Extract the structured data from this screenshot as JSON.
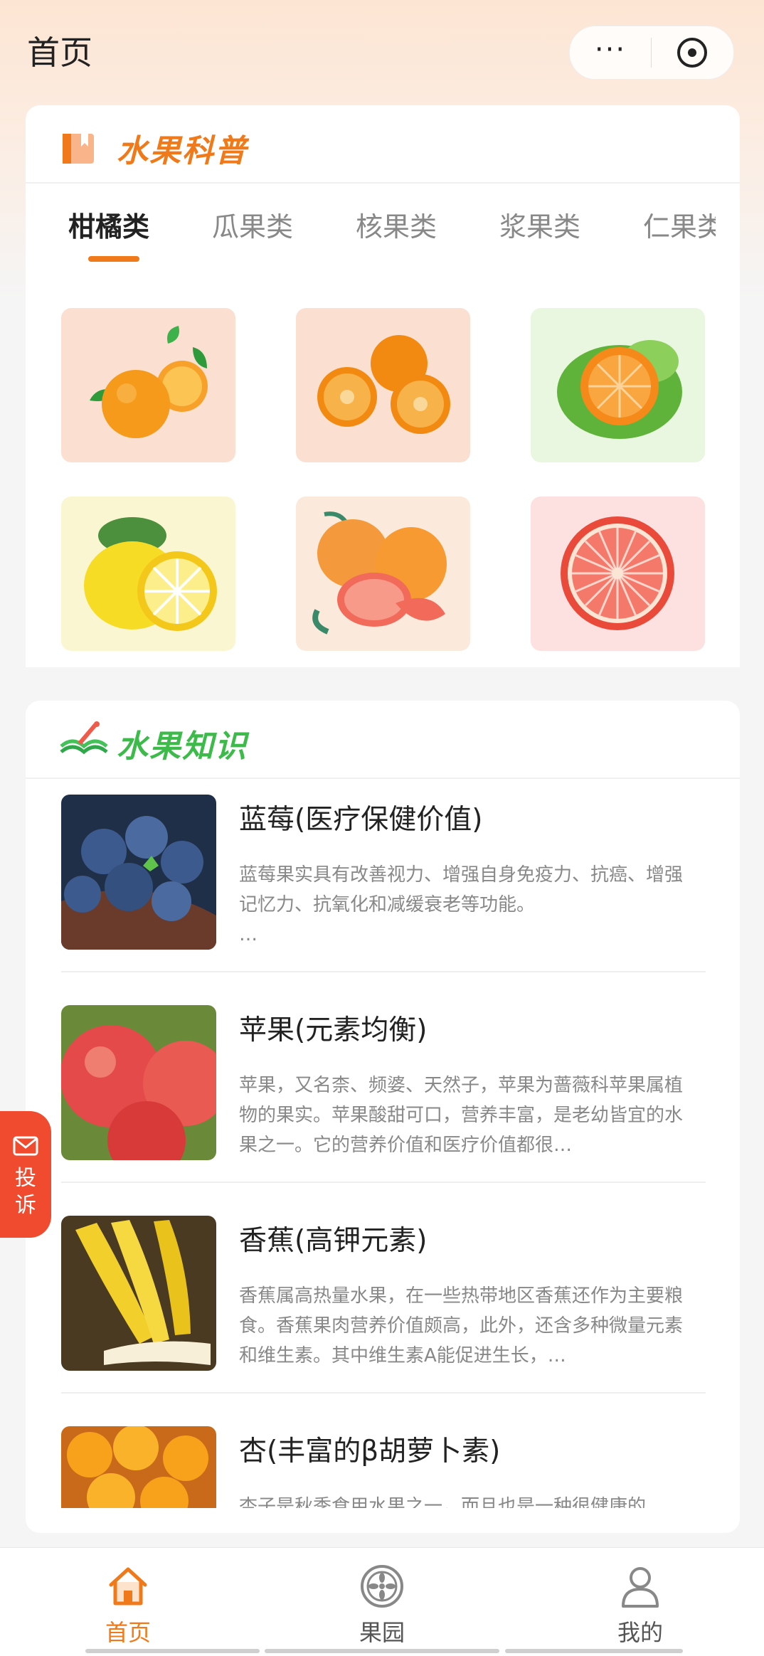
{
  "nav": {
    "title": "首页",
    "more_glyph": "···",
    "close_icon": "close-circle-icon"
  },
  "science": {
    "title": "水果科普",
    "icon": "book-icon",
    "accent": "#f07a1a",
    "tabs": [
      {
        "label": "柑橘类",
        "active": true
      },
      {
        "label": "瓜果类",
        "active": false
      },
      {
        "label": "核果类",
        "active": false
      },
      {
        "label": "浆果类",
        "active": false
      },
      {
        "label": "仁果类",
        "active": false
      }
    ],
    "tiles": [
      {
        "name": "orange",
        "bg": "#fbe0d2"
      },
      {
        "name": "kumquat",
        "bg": "#fbe0d2"
      },
      {
        "name": "green-tangerine",
        "bg": "#eaf7e0"
      },
      {
        "name": "lemon",
        "bg": "#fbf6d2"
      },
      {
        "name": "grapefruit",
        "bg": "#fbeadb"
      },
      {
        "name": "grapefruit-slice",
        "bg": "#fde0e0"
      }
    ]
  },
  "knowledge": {
    "title": "水果知识",
    "icon": "reading-icon",
    "accent": "#3dbb4a",
    "articles": [
      {
        "title": "蓝莓(医疗保健价值)",
        "desc": "蓝莓果实具有改善视力、增强自身免疫力、抗癌、增强记忆力、抗氧化和减缓衰老等功能。\n…",
        "thumb": "blueberry"
      },
      {
        "title": "苹果(元素均衡)",
        "desc": "苹果，又名柰、频婆、天然子，苹果为蔷薇科苹果属植物的果实。苹果酸甜可口，营养丰富，是老幼皆宜的水果之一。它的营养价值和医疗价值都很…",
        "thumb": "apple"
      },
      {
        "title": "香蕉(高钾元素)",
        "desc": "香蕉属高热量水果，在一些热带地区香蕉还作为主要粮食。香蕉果肉营养价值颇高，此外，还含多种微量元素和维生素。其中维生素A能促进生长，…",
        "thumb": "banana"
      },
      {
        "title": "杏(丰富的β胡萝卜素)",
        "desc": "杏子是秋季食用水果之一，而且也是一种很健康的",
        "thumb": "apricot"
      }
    ]
  },
  "complaint": {
    "label": "投诉",
    "icon": "mail-icon"
  },
  "tabbar": {
    "items": [
      {
        "label": "首页",
        "icon": "home-icon",
        "active": true
      },
      {
        "label": "果园",
        "icon": "orchard-icon",
        "active": false
      },
      {
        "label": "我的",
        "icon": "user-icon",
        "active": false
      }
    ]
  }
}
